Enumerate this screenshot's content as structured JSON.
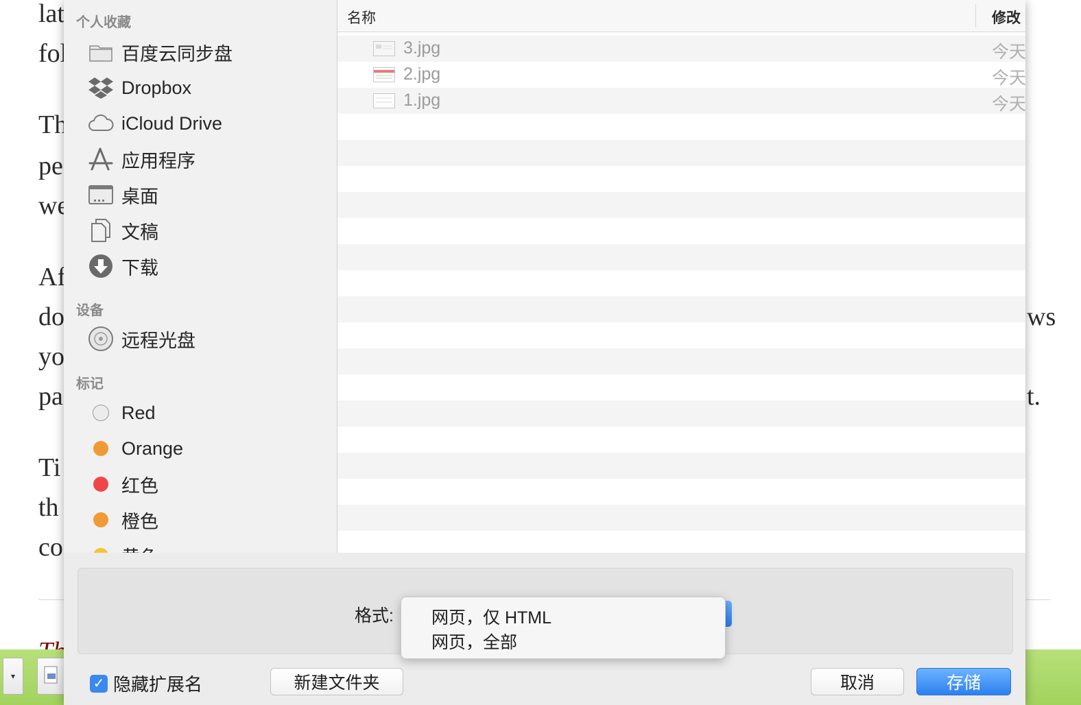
{
  "background_doc": {
    "left_fragments": [
      "lat",
      "fol",
      "Th",
      "pe",
      "we",
      "Af",
      "do",
      "yo",
      "pa",
      "Ti",
      "th",
      "co"
    ],
    "right_fragments": [
      "ws",
      "t."
    ],
    "bottom_fragment": "Th"
  },
  "sidebar": {
    "sections": [
      {
        "title": "个人收藏",
        "items": [
          {
            "label": "百度云同步盘",
            "icon": "folder-icon"
          },
          {
            "label": "Dropbox",
            "icon": "dropbox-icon"
          },
          {
            "label": "iCloud Drive",
            "icon": "cloud-icon"
          },
          {
            "label": "应用程序",
            "icon": "applications-icon"
          },
          {
            "label": "桌面",
            "icon": "desktop-icon"
          },
          {
            "label": "文稿",
            "icon": "documents-icon"
          },
          {
            "label": "下载",
            "icon": "download-icon"
          }
        ]
      },
      {
        "title": "设备",
        "items": [
          {
            "label": "远程光盘",
            "icon": "disc-icon"
          }
        ]
      },
      {
        "title": "标记",
        "items": [
          {
            "label": "Red",
            "color": "#e8e8e8"
          },
          {
            "label": "Orange",
            "color": "#f09a36"
          },
          {
            "label": "红色",
            "color": "#ef4747"
          },
          {
            "label": "橙色",
            "color": "#f09a36"
          },
          {
            "label": "黄色",
            "color": "#f5c431"
          }
        ]
      }
    ]
  },
  "file_list": {
    "columns": {
      "name": "名称",
      "modified": "修改"
    },
    "files": [
      {
        "name": "3.jpg",
        "modified": "今天"
      },
      {
        "name": "2.jpg",
        "modified": "今天"
      },
      {
        "name": "1.jpg",
        "modified": "今天"
      }
    ]
  },
  "format": {
    "label": "格式:",
    "options": [
      "网页，仅 HTML",
      "网页，全部"
    ]
  },
  "hide_extension": {
    "label": "隐藏扩展名",
    "checked": true
  },
  "buttons": {
    "new_folder": "新建文件夹",
    "cancel": "取消",
    "save": "存储"
  }
}
